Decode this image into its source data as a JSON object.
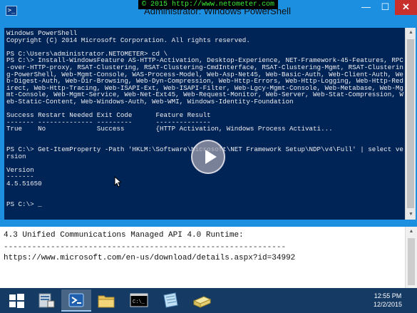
{
  "watermark": {
    "text": "© 2015 http://www.netometer.com"
  },
  "window": {
    "title": "Administrator: Windows PowerShell",
    "icon": "powershell-icon",
    "controls": {
      "minimize": "—",
      "maximize": "☐",
      "close": "✕"
    }
  },
  "console": {
    "text": "Windows PowerShell\nCopyright (C) 2014 Microsoft Corporation. All rights reserved.\n\nPS C:\\Users\\administrator.NETOMETER> cd \\\nPS C:\\> Install-WindowsFeature AS-HTTP-Activation, Desktop-Experience, NET-Framework-45-Features, RPC-over-HTTP-proxy, RSAT-Clustering, RSAT-Clustering-CmdInterface, RSAT-Clustering-Mgmt, RSAT-Clustering-PowerShell, Web-Mgmt-Console, WAS-Process-Model, Web-Asp-Net45, Web-Basic-Auth, Web-Client-Auth, Web-Digest-Auth, Web-Dir-Browsing, Web-Dyn-Compression, Web-Http-Errors, Web-Http-Logging, Web-Http-Redirect, Web-Http-Tracing, Web-ISAPI-Ext, Web-ISAPI-Filter, Web-Lgcy-Mgmt-Console, Web-Metabase, Web-Mgmt-Console, Web-Mgmt-Service, Web-Net-Ext45, Web-Request-Monitor, Web-Server, Web-Stat-Compression, Web-Static-Content, Web-Windows-Auth, Web-WMI, Windows-Identity-Foundation\n\nSuccess Restart Needed Exit Code      Feature Result\n------- -------------- ---------      --------------\nTrue    No             Success        {HTTP Activation, Windows Process Activati...\n\n\nPS C:\\> Get-ItemProperty -Path 'HKLM:\\Software\\Microsoft\\NET Framework Setup\\NDP\\v4\\Full' | select version\n\nVersion\n-------\n4.5.51650\n\n\nPS C:\\> _"
  },
  "document": {
    "lines": [
      "4.3 Unified Communications Managed API 4.0 Runtime:",
      "------------------------------------------------------------",
      "https://www.microsoft.com/en-us/download/details.aspx?id=34992"
    ]
  },
  "taskbar": {
    "items": [
      "start-icon",
      "server-manager-icon",
      "powershell-icon",
      "file-explorer-icon",
      "command-prompt-icon",
      "notepad-icon",
      "installer-icon"
    ],
    "active_index": 2,
    "time": "12:55 PM",
    "date": "12/2/2015"
  },
  "colors": {
    "console_bg": "#012456",
    "console_fg": "#eeedf0",
    "window_frame": "#1d8fe1",
    "taskbar": "#153a64",
    "close_button": "#c7302b"
  }
}
